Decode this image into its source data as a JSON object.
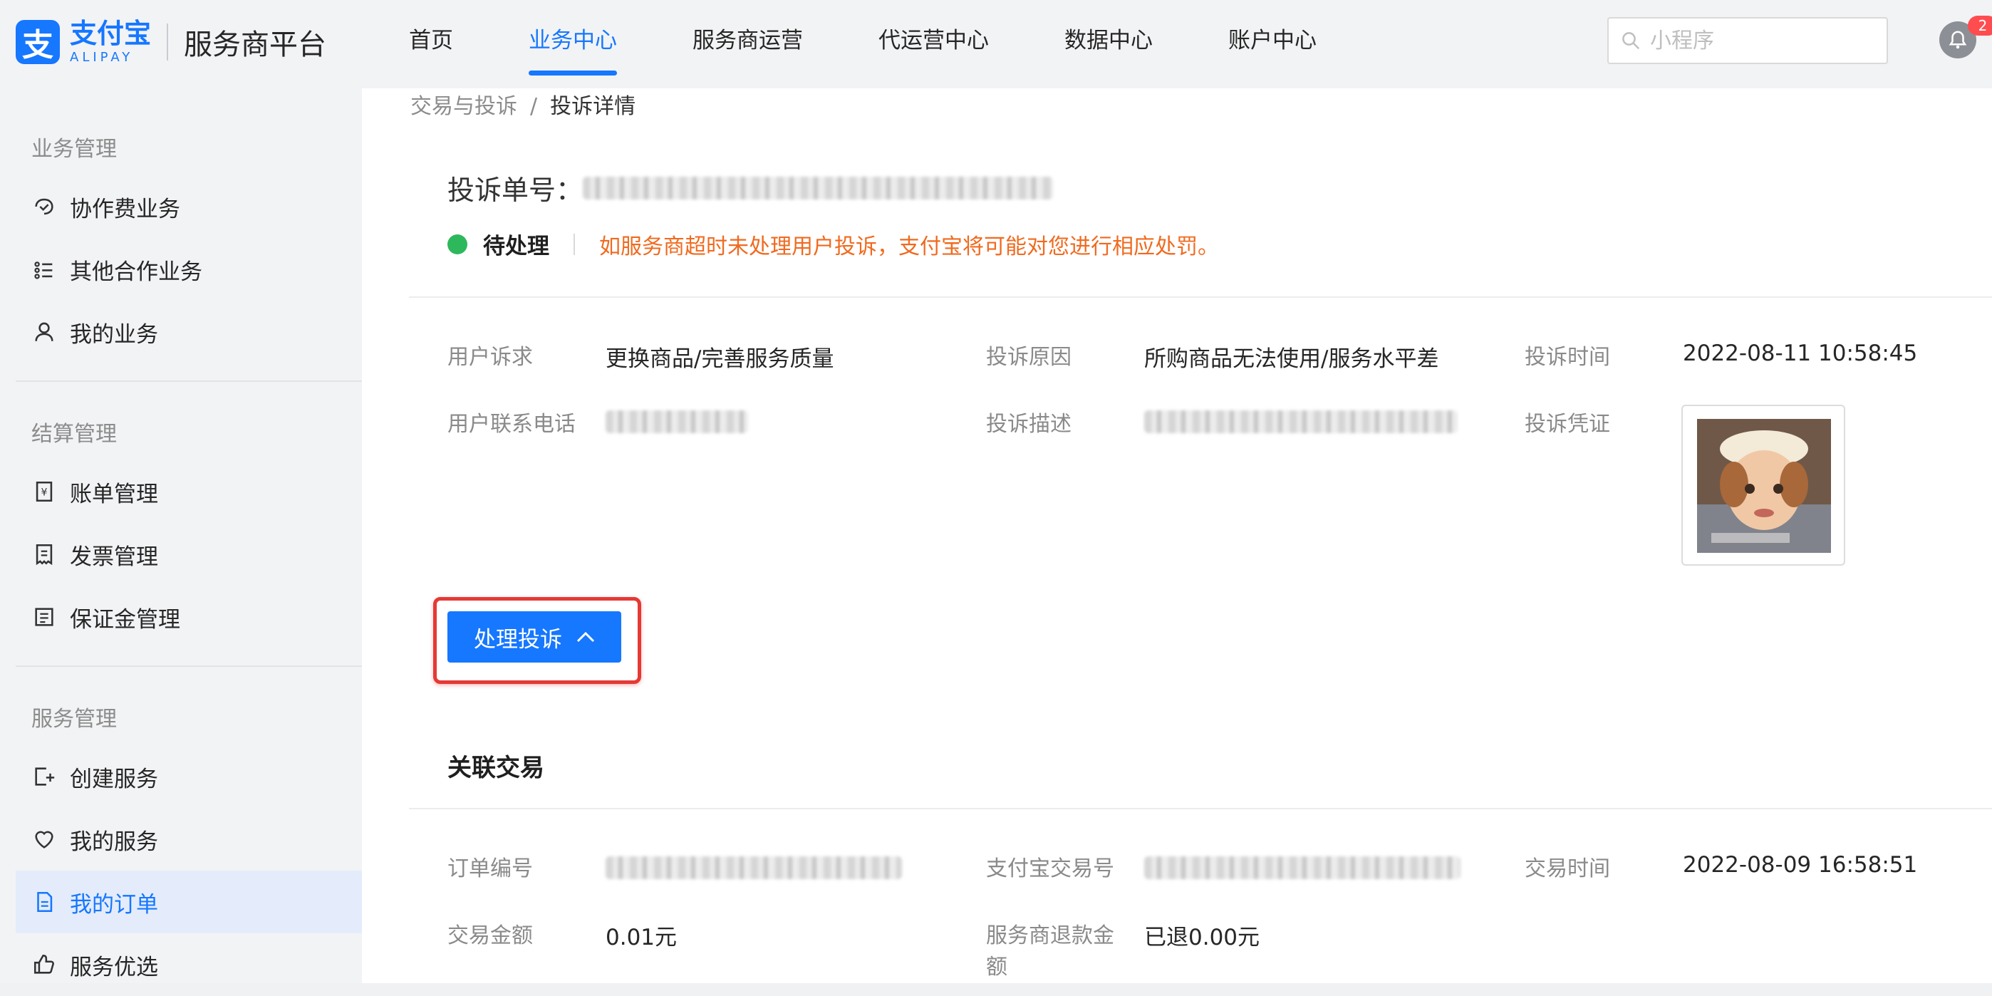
{
  "header": {
    "logo_cn": "支付宝",
    "logo_en": "ALIPAY",
    "platform": "服务商平台",
    "nav": [
      {
        "label": "首页",
        "active": false
      },
      {
        "label": "业务中心",
        "active": true
      },
      {
        "label": "服务商运营",
        "active": false
      },
      {
        "label": "代运营中心",
        "active": false
      },
      {
        "label": "数据中心",
        "active": false
      },
      {
        "label": "账户中心",
        "active": false
      }
    ],
    "search_placeholder": "小程序",
    "badge": "2"
  },
  "sidebar": {
    "groups": [
      {
        "title": "业务管理",
        "items": [
          {
            "label": "协作费业务",
            "icon": "handshake-icon"
          },
          {
            "label": "其他合作业务",
            "icon": "list-icon"
          },
          {
            "label": "我的业务",
            "icon": "user-icon"
          }
        ]
      },
      {
        "title": "结算管理",
        "items": [
          {
            "label": "账单管理",
            "icon": "bill-icon"
          },
          {
            "label": "发票管理",
            "icon": "receipt-icon"
          },
          {
            "label": "保证金管理",
            "icon": "document-icon"
          }
        ]
      },
      {
        "title": "服务管理",
        "items": [
          {
            "label": "创建服务",
            "icon": "create-icon"
          },
          {
            "label": "我的服务",
            "icon": "heart-icon"
          },
          {
            "label": "我的订单",
            "icon": "order-icon",
            "active": true
          },
          {
            "label": "服务优选",
            "icon": "thumbs-up-icon"
          }
        ]
      }
    ]
  },
  "breadcrumb": {
    "parent": "交易与投诉",
    "separator": "/",
    "current": "投诉详情"
  },
  "complaint": {
    "title_label": "投诉单号：",
    "status": "待处理",
    "warning": "如服务商超时未处理用户投诉，支付宝将可能对您进行相应处罚。",
    "fields": {
      "demand_label": "用户诉求",
      "demand_value": "更换商品/完善服务质量",
      "reason_label": "投诉原因",
      "reason_value": "所购商品无法使用/服务水平差",
      "time_label": "投诉时间",
      "time_value": "2022-08-11 10:58:45",
      "phone_label": "用户联系电话",
      "desc_label": "投诉描述",
      "evidence_label": "投诉凭证"
    },
    "handle_button": "处理投诉"
  },
  "related": {
    "title": "关联交易",
    "order_no_label": "订单编号",
    "alipay_trade_label": "支付宝交易号",
    "trade_time_label": "交易时间",
    "trade_time_value": "2022-08-09 16:58:51",
    "amount_label": "交易金额",
    "amount_value": "0.01元",
    "refund_label_line1": "服务商退款金",
    "refund_label_line2": "额",
    "refund_value": "已退0.00元"
  },
  "colors": {
    "accent": "#1677ff",
    "warning": "#f06a1f",
    "status_green": "#2eb85c",
    "highlight_red": "#e53935"
  }
}
